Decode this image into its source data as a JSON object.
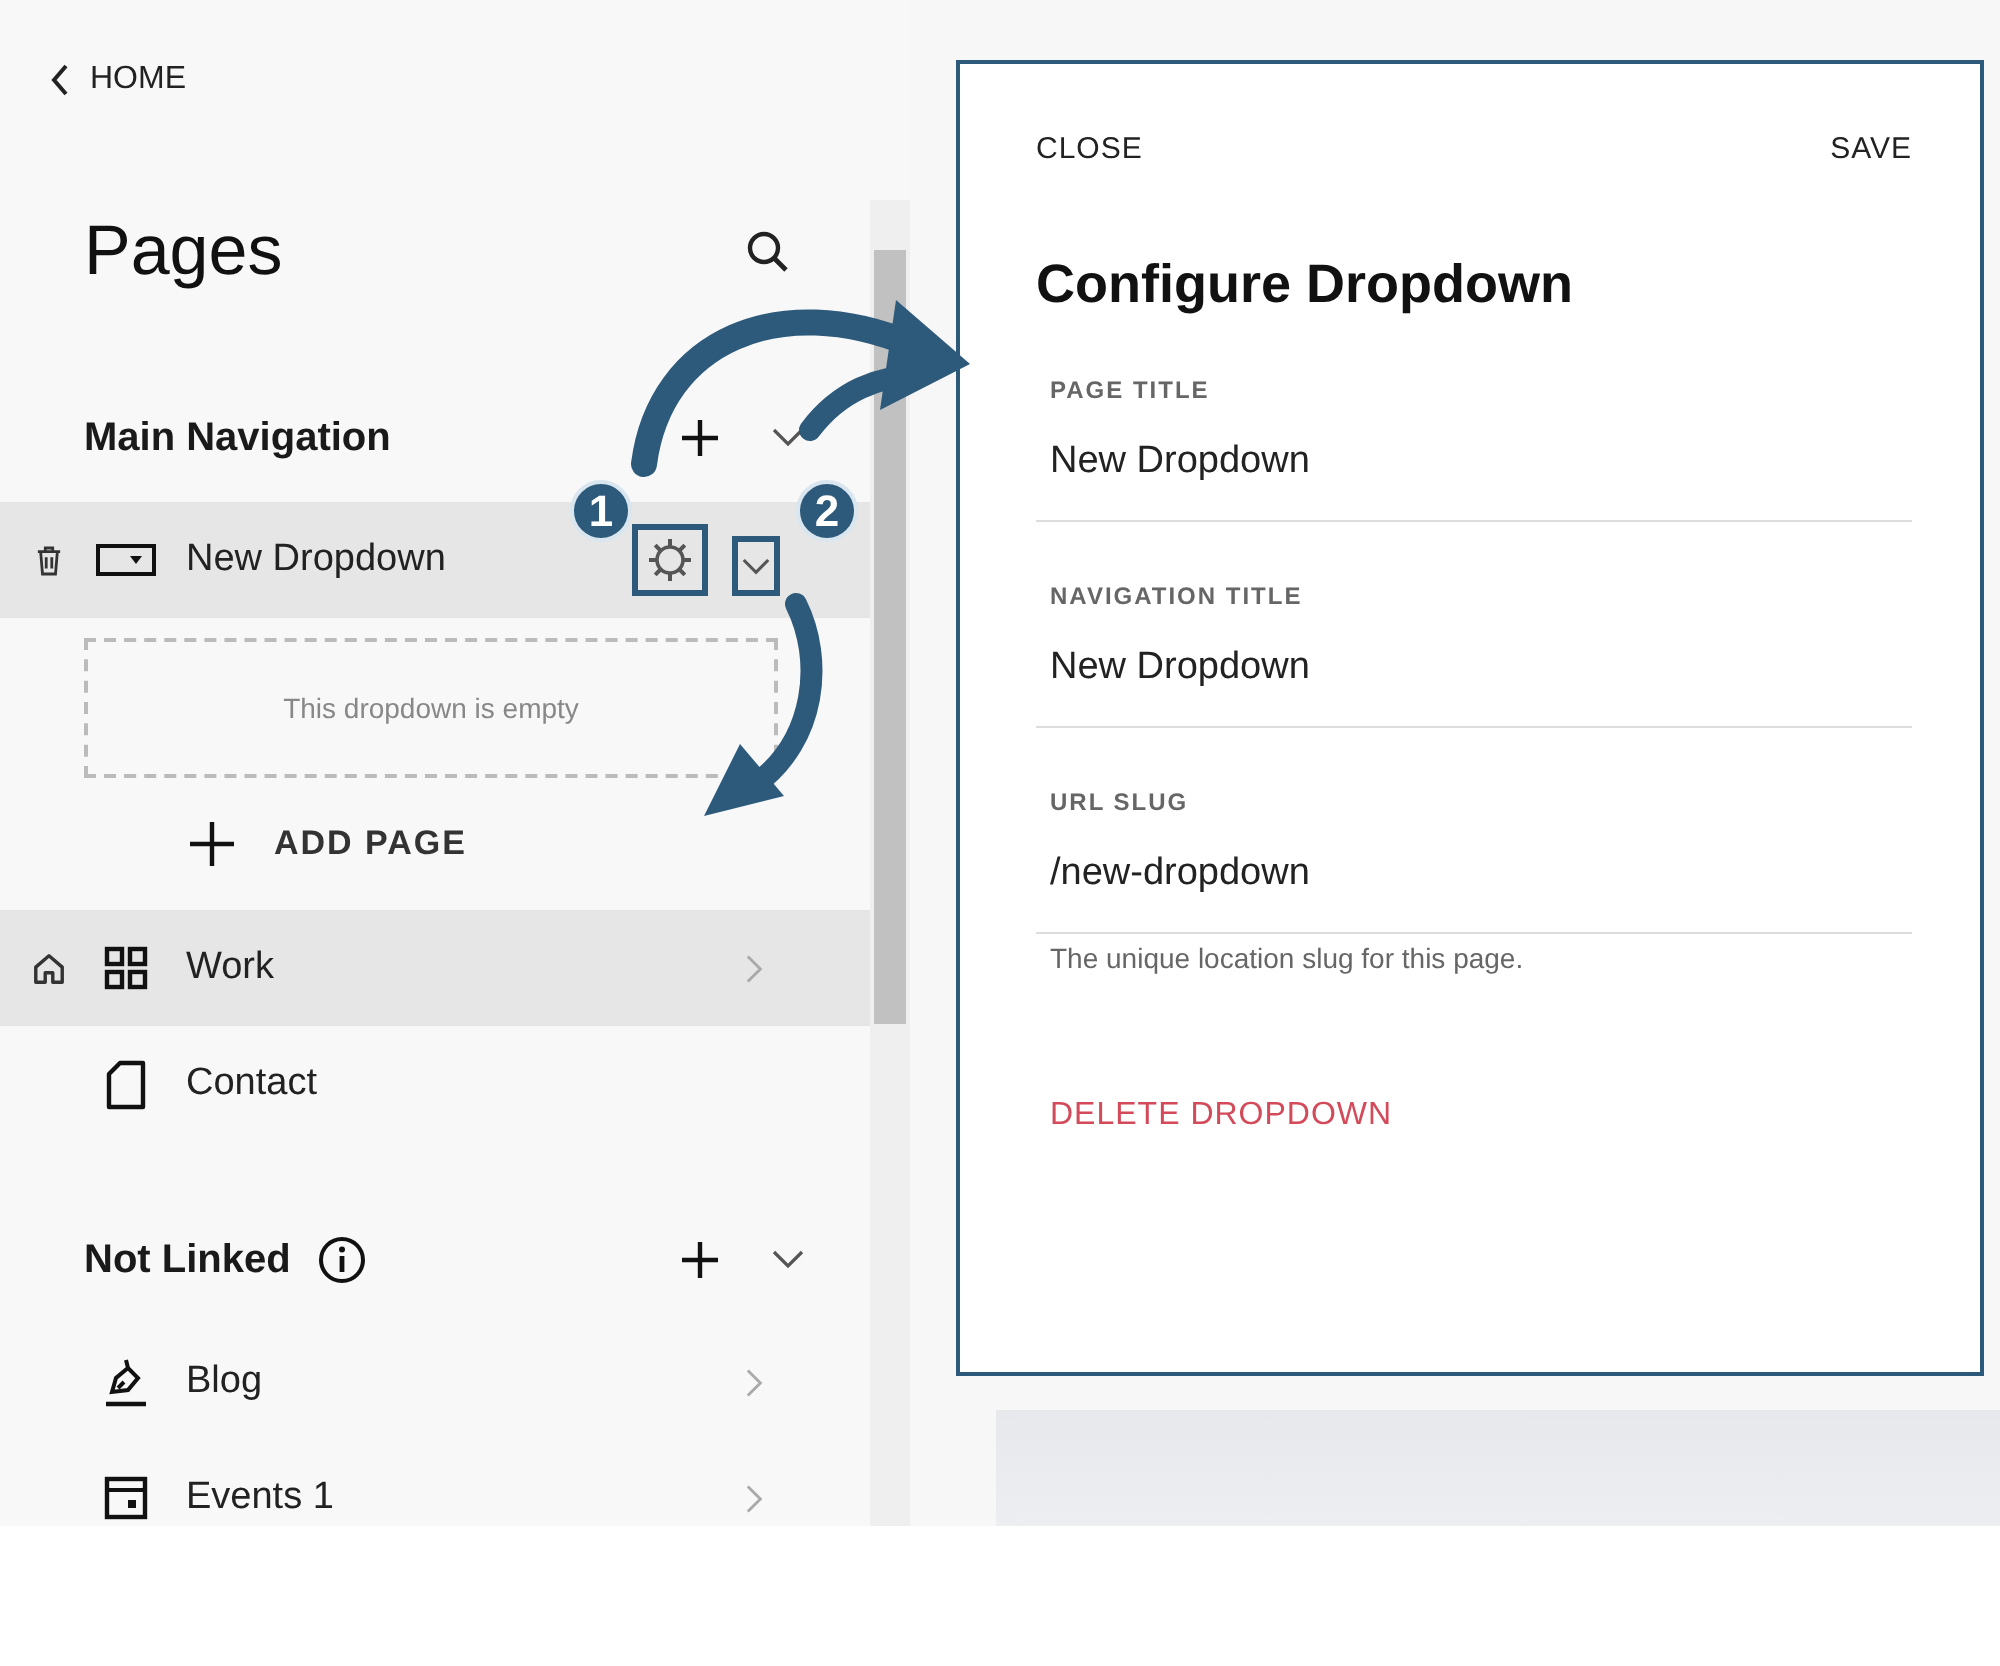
{
  "back_link": {
    "label": "HOME"
  },
  "sidebar": {
    "title": "Pages",
    "sections": [
      {
        "title": "Main Navigation",
        "info": false,
        "expanded": true,
        "items": [
          {
            "label": "New Dropdown",
            "kind": "dropdown",
            "selected": true,
            "homepage": false,
            "empty_text": "This dropdown is empty",
            "add_label": "ADD PAGE"
          },
          {
            "label": "Work",
            "kind": "index",
            "selected": true,
            "homepage": true
          },
          {
            "label": "Contact",
            "kind": "page",
            "selected": false,
            "homepage": false
          }
        ]
      },
      {
        "title": "Not Linked",
        "info": true,
        "expanded": true,
        "items": [
          {
            "label": "Blog",
            "kind": "blog",
            "selected": false,
            "homepage": false
          },
          {
            "label": "Events 1",
            "kind": "events",
            "selected": false,
            "homepage": false
          }
        ]
      }
    ]
  },
  "panel": {
    "close": "CLOSE",
    "save": "SAVE",
    "title": "Configure Dropdown",
    "fields": [
      {
        "label": "PAGE TITLE",
        "value": "New Dropdown"
      },
      {
        "label": "NAVIGATION TITLE",
        "value": "New Dropdown"
      },
      {
        "label": "URL SLUG",
        "value": "/new-dropdown",
        "help": "The unique location slug for this page."
      }
    ],
    "delete": "DELETE DROPDOWN"
  },
  "callouts": [
    {
      "number": "1"
    },
    {
      "number": "2"
    }
  ]
}
